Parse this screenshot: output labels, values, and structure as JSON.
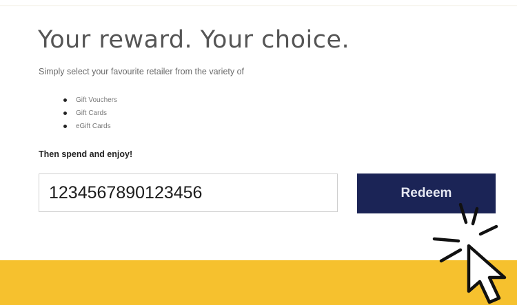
{
  "hero": {
    "title": "Your reward. Your choice.",
    "subtitle": "Simply select your favourite retailer from the variety of",
    "options": [
      "Gift Vouchers",
      "Gift Cards",
      "eGift Cards"
    ],
    "cta": "Then spend and enjoy!"
  },
  "redeem_form": {
    "code_value": "1234567890123456",
    "button_label": "Redeem"
  },
  "colors": {
    "button_bg": "#1b2456",
    "footer_band": "#f6c12e"
  },
  "icons": {
    "pointer": "hand-pointer-icon",
    "click_burst": "click-burst-icon"
  }
}
